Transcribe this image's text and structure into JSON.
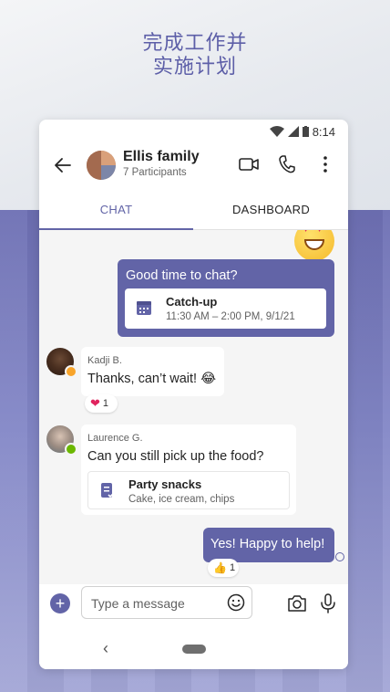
{
  "promo": {
    "line1": "完成工作并",
    "line2": "实施计划"
  },
  "status_bar": {
    "time": "8:14"
  },
  "header": {
    "title": "Ellis family",
    "subtitle": "7 Participants"
  },
  "tabs": [
    {
      "label": "CHAT",
      "active": true
    },
    {
      "label": "DASHBOARD",
      "active": false
    }
  ],
  "messages": {
    "outgoing_1": {
      "text": "Good time to chat?",
      "card": {
        "title": "Catch-up",
        "subtitle": "11:30 AM – 2:00 PM, 9/1/21"
      }
    },
    "incoming_1": {
      "sender": "Kadji B.",
      "text": "Thanks, can’t wait! 😂",
      "reaction": {
        "emoji": "❤",
        "count": "1"
      }
    },
    "incoming_2": {
      "sender": "Laurence G.",
      "text": "Can you still pick up the food?",
      "card": {
        "title": "Party snacks",
        "subtitle": "Cake, ice cream, chips"
      }
    },
    "outgoing_2": {
      "text": "Yes! Happy to help!",
      "reaction": {
        "emoji": "👍",
        "count": "1"
      }
    }
  },
  "composer": {
    "placeholder": "Type a message"
  },
  "colors": {
    "accent": "#6264a7",
    "heart": "#e0245e",
    "presence_away": "#f8a42a",
    "presence_available": "#6bb700"
  }
}
